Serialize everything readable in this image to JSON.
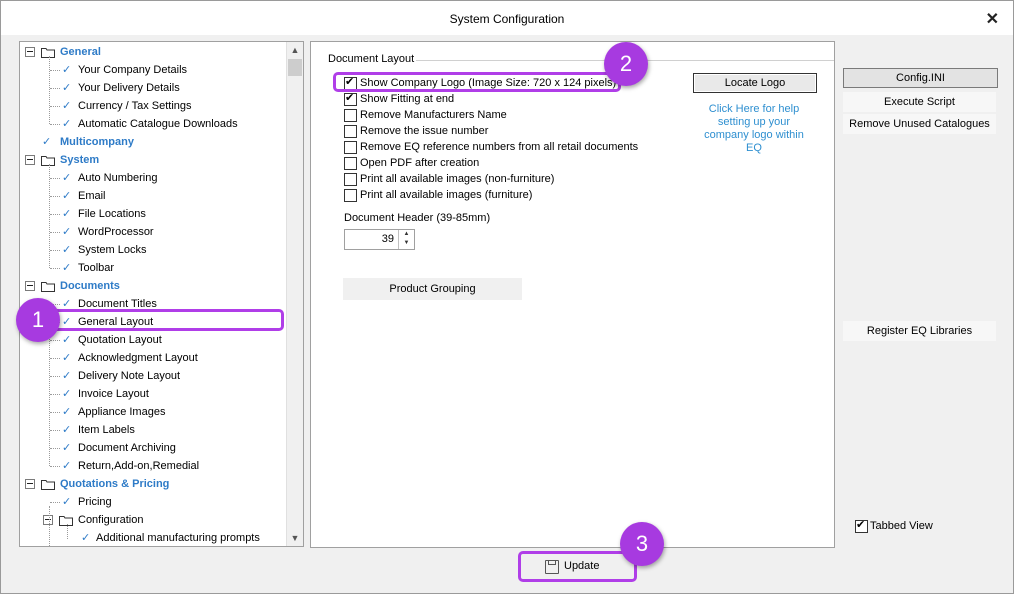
{
  "window": {
    "title": "System Configuration",
    "close_glyph": "✕"
  },
  "tree": {
    "nodes": [
      {
        "label": "General",
        "type": "cat"
      },
      {
        "label": "Your Company Details",
        "type": "item"
      },
      {
        "label": "Your Delivery Details",
        "type": "item"
      },
      {
        "label": "Currency / Tax Settings",
        "type": "item"
      },
      {
        "label": "Automatic Catalogue Downloads",
        "type": "item"
      },
      {
        "label": "Multicompany",
        "type": "cat"
      },
      {
        "label": "System",
        "type": "cat"
      },
      {
        "label": "Auto Numbering",
        "type": "item"
      },
      {
        "label": "Email",
        "type": "item"
      },
      {
        "label": "File Locations",
        "type": "item"
      },
      {
        "label": "WordProcessor",
        "type": "item"
      },
      {
        "label": "System Locks",
        "type": "item"
      },
      {
        "label": "Toolbar",
        "type": "item"
      },
      {
        "label": "Documents",
        "type": "cat"
      },
      {
        "label": "Document Titles",
        "type": "item"
      },
      {
        "label": "General Layout",
        "type": "item",
        "selected": true
      },
      {
        "label": "Quotation Layout",
        "type": "item"
      },
      {
        "label": "Acknowledgment Layout",
        "type": "item"
      },
      {
        "label": "Delivery Note Layout",
        "type": "item"
      },
      {
        "label": "Invoice Layout",
        "type": "item"
      },
      {
        "label": "Appliance Images",
        "type": "item"
      },
      {
        "label": "Item Labels",
        "type": "item"
      },
      {
        "label": "Document Archiving",
        "type": "item"
      },
      {
        "label": "Return,Add-on,Remedial",
        "type": "item"
      },
      {
        "label": "Quotations & Pricing",
        "type": "cat"
      },
      {
        "label": "Pricing",
        "type": "item"
      },
      {
        "label": "Configuration",
        "type": "subcat"
      },
      {
        "label": "Additional manufacturing prompts",
        "type": "subitem"
      }
    ]
  },
  "document_layout": {
    "group_label": "Document Layout",
    "options": [
      {
        "label": "Show Company Logo  (Image Size: 720 x 124 pixels)",
        "checked": true
      },
      {
        "label": "Show Fitting at end",
        "checked": true
      },
      {
        "label": "Remove Manufacturers Name",
        "checked": false
      },
      {
        "label": "Remove the issue number",
        "checked": false
      },
      {
        "label": "Remove EQ reference numbers from all retail documents",
        "checked": false
      },
      {
        "label": "Open PDF after creation",
        "checked": false
      },
      {
        "label": "Print all available images (non-furniture)",
        "checked": false
      },
      {
        "label": "Print all available images (furniture)",
        "checked": false
      }
    ],
    "locate_logo_label": "Locate Logo",
    "help_text": "Click Here for help setting up your company logo within EQ",
    "header_label": "Document Header (39-85mm)",
    "header_value": "39",
    "product_grouping_label": "Product Grouping"
  },
  "right_panel": {
    "config_ini": "Config.INI",
    "execute_script": "Execute Script",
    "remove_unused": "Remove Unused Catalogues",
    "register_eq": "Register EQ Libraries",
    "tabbed_view": "Tabbed View",
    "tabbed_view_checked": true
  },
  "footer": {
    "update_label": "Update"
  },
  "annotations": {
    "badge1": "1",
    "badge2": "2",
    "badge3": "3",
    "highlight_color": "#b03ee8"
  }
}
